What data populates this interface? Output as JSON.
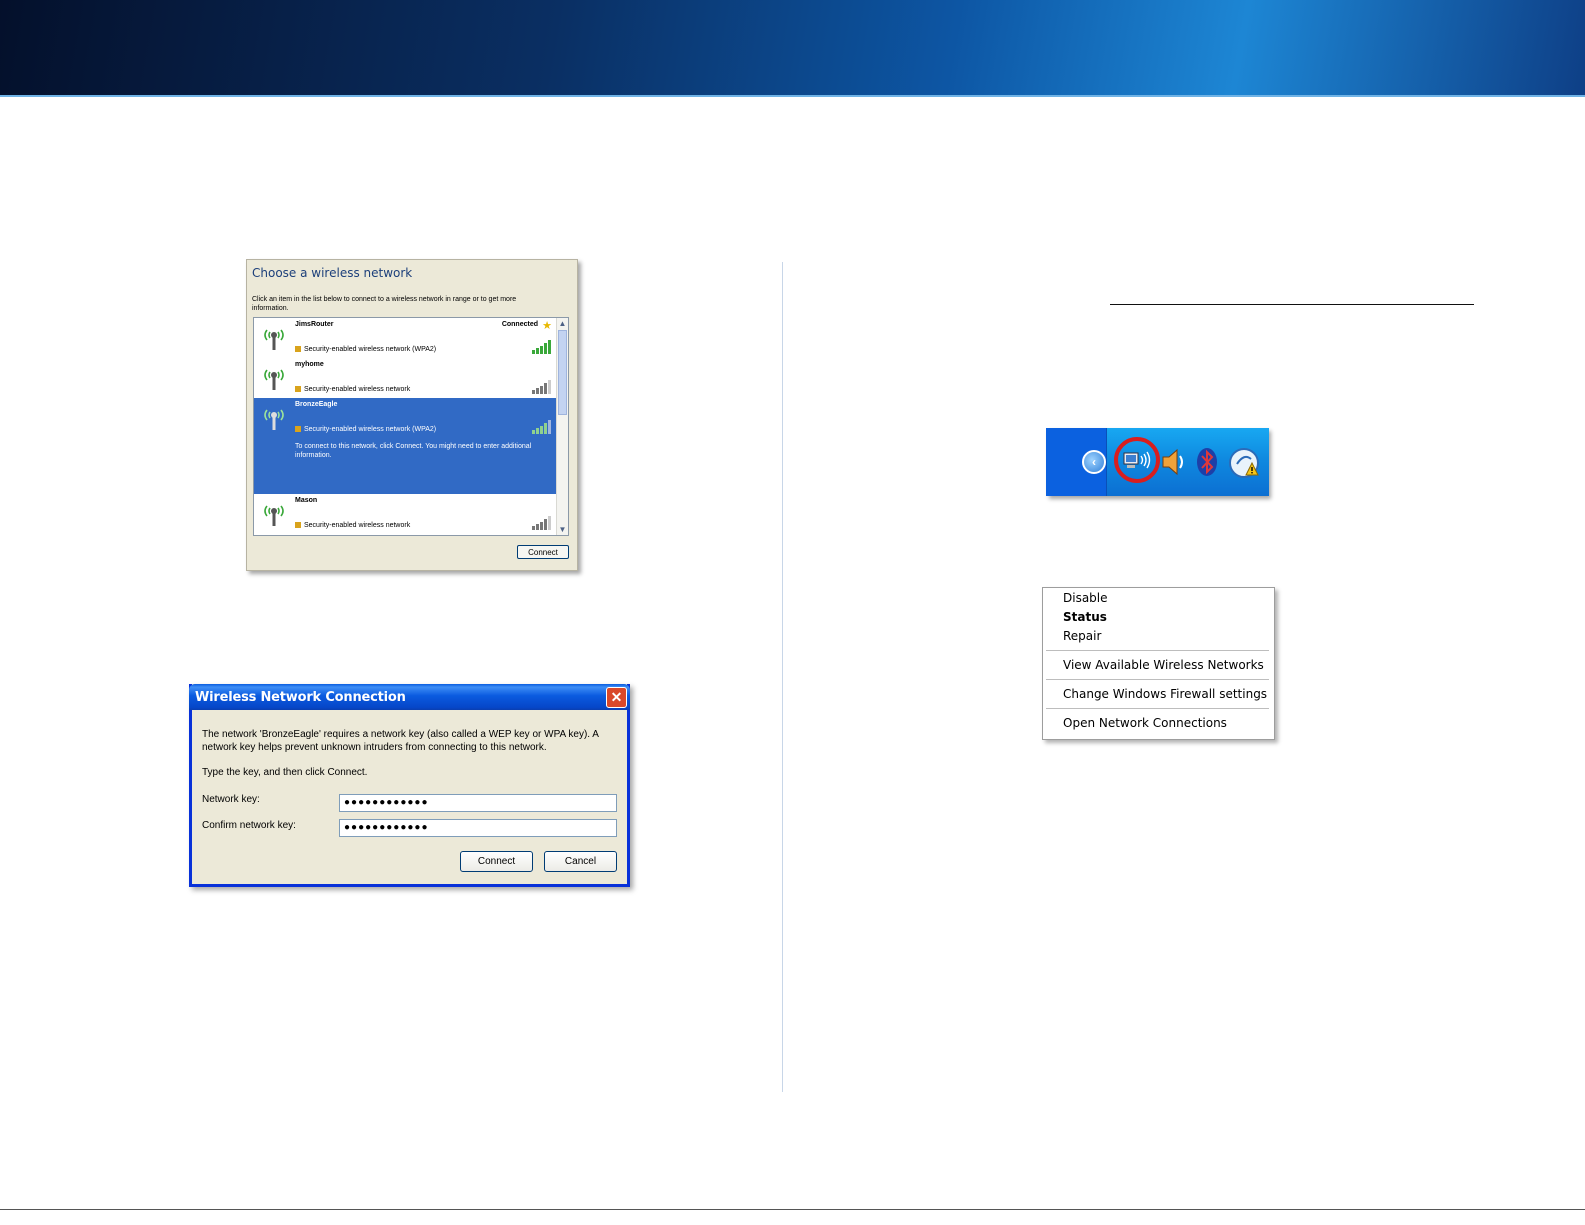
{
  "choose_network": {
    "title": "Choose a wireless network",
    "description": "Click an item in the list below to connect to a wireless network in range or to get more information.",
    "networks": [
      {
        "name": "JimsRouter",
        "status": "Connected",
        "security": "Security-enabled wireless network (WPA2)",
        "signal": 5
      },
      {
        "name": "myhome",
        "status": "",
        "security": "Security-enabled wireless network",
        "signal": 4
      },
      {
        "name": "BronzeEagle",
        "status": "",
        "security": "Security-enabled wireless network (WPA2)",
        "hint": "To connect to this network, click Connect. You might need to enter additional information.",
        "signal": 4
      },
      {
        "name": "Mason",
        "status": "",
        "security": "Security-enabled wireless network",
        "signal": 4
      }
    ],
    "connect_label": "Connect"
  },
  "dialog": {
    "title": "Wireless Network Connection",
    "message": "The network 'BronzeEagle' requires a network key (also called a WEP key or WPA key). A network key helps prevent unknown intruders from connecting to this network.",
    "instruction": "Type the key, and then click Connect.",
    "network_key_label": "Network key:",
    "network_key_value": "●●●●●●●●●●●●",
    "confirm_key_label": "Confirm network key:",
    "confirm_key_value": "●●●●●●●●●●●●",
    "connect_label": "Connect",
    "cancel_label": "Cancel",
    "close_glyph": "✕"
  },
  "tray": {
    "icons": [
      "back-arrow-icon",
      "wireless-network-icon",
      "volume-icon",
      "bluetooth-icon",
      "security-alert-icon"
    ],
    "highlight_color": "#d81e1e"
  },
  "context_menu": {
    "items": [
      "Disable",
      "Status",
      "Repair",
      "View Available Wireless Networks",
      "Change Windows Firewall settings",
      "Open Network Connections"
    ]
  },
  "colors": {
    "selection": "#316ac5",
    "titlebar": "#0a5ee0",
    "dialog_bg": "#ece9d8"
  }
}
